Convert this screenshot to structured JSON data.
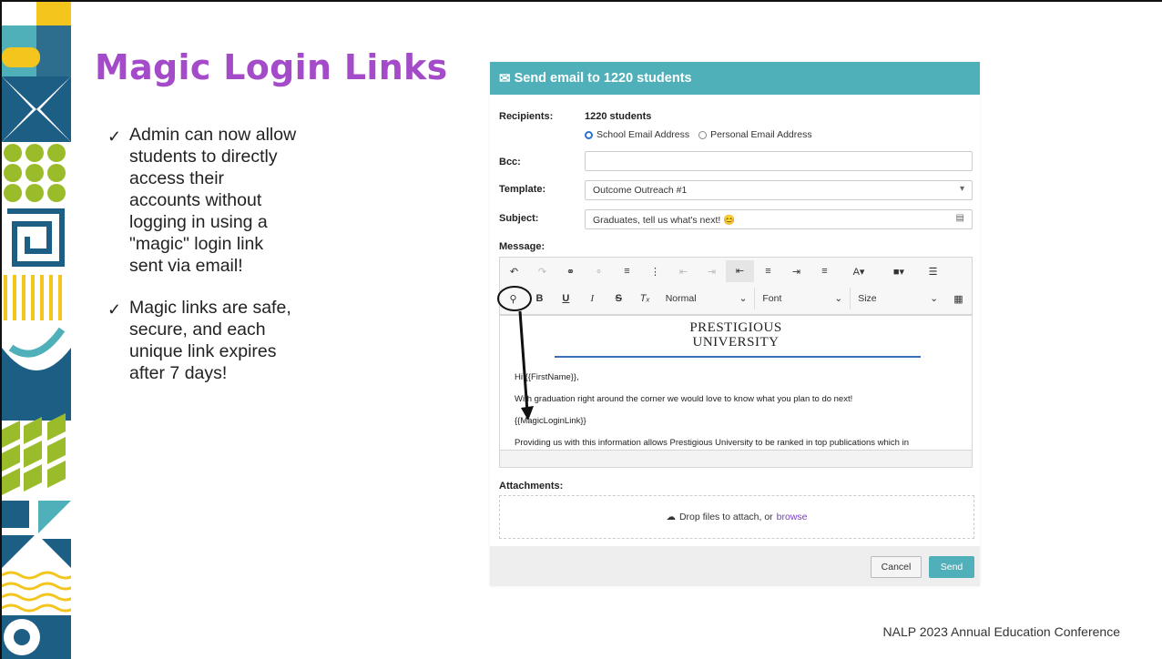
{
  "slide": {
    "title": "Magic Login Links",
    "bullets": [
      "Admin can now allow students to directly access their accounts without logging in using a \"magic\" login link sent via email!",
      "Magic links are safe, secure, and each unique link expires after 7 days!"
    ],
    "check_glyph": "✓",
    "footer": "NALP 2023 Annual Education Conference",
    "colors": {
      "title": "#a34bc8",
      "accent": "#4fb0b9"
    }
  },
  "dialog": {
    "header": "Send email to 1220 students",
    "header_icon": "mail-icon",
    "recipients_label": "Recipients:",
    "recipients_value": "1220 students",
    "radio_school": "School Email Address",
    "radio_personal": "Personal Email Address",
    "radio_selected": "School Email Address",
    "bcc_label": "Bcc:",
    "bcc_value": "",
    "template_label": "Template:",
    "template_value": "Outcome Outreach #1",
    "subject_label": "Subject:",
    "subject_value": "Graduates, tell us what's next! 😊",
    "message_label": "Message:",
    "toolbar": {
      "format_select": "Normal",
      "font_select": "Font",
      "size_select": "Size",
      "bold": "B",
      "underline": "U",
      "italic": "I",
      "strike": "S",
      "clear": "Tₓ"
    },
    "editor": {
      "university_line1": "PRESTIGIOUS",
      "university_line2": "UNIVERSITY",
      "greeting": "Hi {{FirstName}},",
      "line1": "With graduation right around the corner we would love to know what you plan to do next!",
      "magic_token": "{{MagicLoginLink}}",
      "line3": "Providing us with this information allows Prestigious University to be ranked in top publications which in"
    },
    "attachments_label": "Attachments:",
    "drop_text": "Drop files to attach, or",
    "drop_link": "browse",
    "cancel_label": "Cancel",
    "send_label": "Send"
  }
}
